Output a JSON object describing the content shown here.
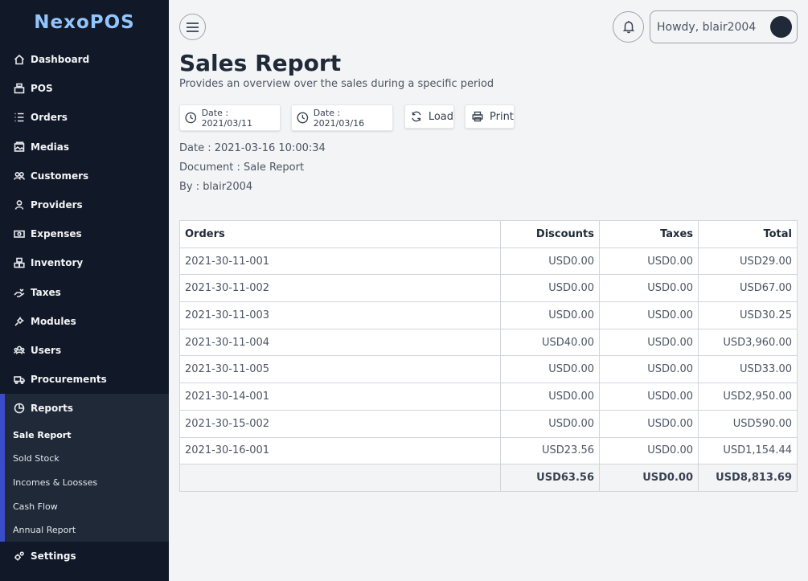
{
  "app": {
    "logo": "NexoPOS"
  },
  "sidebar": {
    "items": [
      {
        "label": "Dashboard",
        "icon": "home-icon"
      },
      {
        "label": "POS",
        "icon": "cash-register-icon"
      },
      {
        "label": "Orders",
        "icon": "list-icon"
      },
      {
        "label": "Medias",
        "icon": "photo-icon"
      },
      {
        "label": "Customers",
        "icon": "user-friends-icon"
      },
      {
        "label": "Providers",
        "icon": "user-icon"
      },
      {
        "label": "Expenses",
        "icon": "money-bill-icon"
      },
      {
        "label": "Inventory",
        "icon": "boxes-icon"
      },
      {
        "label": "Taxes",
        "icon": "hand-holding-icon"
      },
      {
        "label": "Modules",
        "icon": "plug-icon"
      },
      {
        "label": "Users",
        "icon": "users-icon"
      },
      {
        "label": "Procurements",
        "icon": "truck-icon"
      }
    ],
    "reports": {
      "label": "Reports",
      "icon": "chart-pie-icon",
      "sub_items": [
        "Sale Report",
        "Sold Stock",
        "Incomes & Loosses",
        "Cash Flow",
        "Annual Report"
      ]
    },
    "settings": {
      "label": "Settings",
      "icon": "cogs-icon"
    }
  },
  "topbar": {
    "greeting": "Howdy, blair2004"
  },
  "header": {
    "title": "Sales Report",
    "subtitle": "Provides an overview over the sales during a specific period"
  },
  "toolbar": {
    "start_date": "Date : 2021/03/11",
    "end_date": "Date : 2021/03/16",
    "load": "Load",
    "print": "Print"
  },
  "meta": {
    "date": "Date : 2021-03-16 10:00:34",
    "document": "Document : Sale Report",
    "by": "By : blair2004"
  },
  "table": {
    "headers": [
      "Orders",
      "Discounts",
      "Taxes",
      "Total"
    ],
    "rows": [
      [
        "2021-30-11-001",
        "USD0.00",
        "USD0.00",
        "USD29.00"
      ],
      [
        "2021-30-11-002",
        "USD0.00",
        "USD0.00",
        "USD67.00"
      ],
      [
        "2021-30-11-003",
        "USD0.00",
        "USD0.00",
        "USD30.25"
      ],
      [
        "2021-30-11-004",
        "USD40.00",
        "USD0.00",
        "USD3,960.00"
      ],
      [
        "2021-30-11-005",
        "USD0.00",
        "USD0.00",
        "USD33.00"
      ],
      [
        "2021-30-14-001",
        "USD0.00",
        "USD0.00",
        "USD2,950.00"
      ],
      [
        "2021-30-15-002",
        "USD0.00",
        "USD0.00",
        "USD590.00"
      ],
      [
        "2021-30-16-001",
        "USD23.56",
        "USD0.00",
        "USD1,154.44"
      ]
    ],
    "totals": [
      "",
      "USD63.56",
      "USD0.00",
      "USD8,813.69"
    ]
  }
}
